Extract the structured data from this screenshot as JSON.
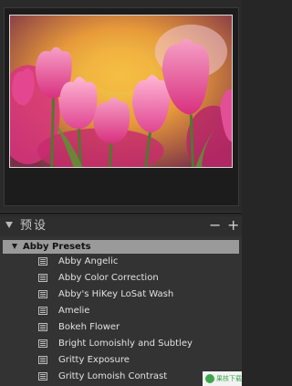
{
  "presets_panel": {
    "title": "预设",
    "minus_label": "−",
    "plus_label": "+",
    "folder": {
      "label": "Abby Presets",
      "items": [
        {
          "label": "Abby Angelic"
        },
        {
          "label": "Abby Color Correction"
        },
        {
          "label": "Abby's HiKey LoSat Wash"
        },
        {
          "label": "Amelie"
        },
        {
          "label": "Bokeh Flower"
        },
        {
          "label": "Bright Lomoishly and Subtley"
        },
        {
          "label": "Gritty Exposure"
        },
        {
          "label": "Gritty Lomoish Contrast"
        }
      ]
    }
  },
  "preview": {
    "subject": "pink tulips"
  },
  "colors": {
    "panel_bg": "#262626",
    "folder_bg": "#9a9a9a",
    "text": "#e2e2e2"
  },
  "watermark": {
    "text": "果核下载"
  }
}
